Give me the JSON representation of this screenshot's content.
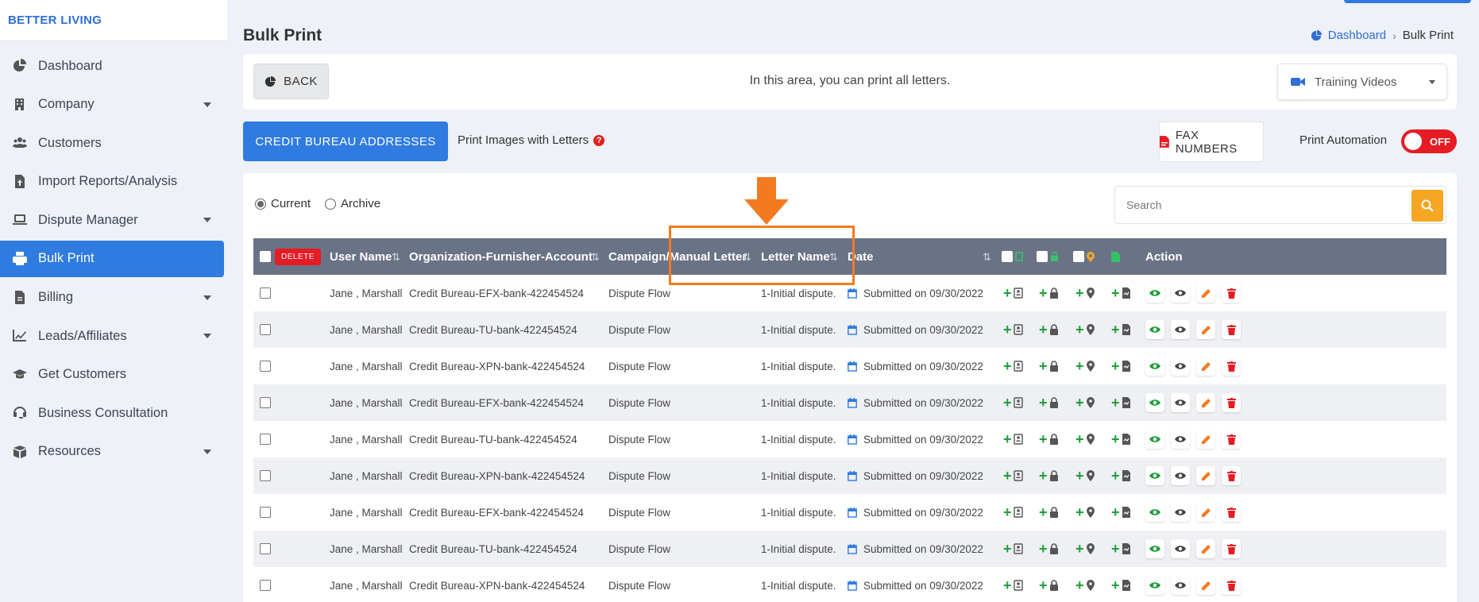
{
  "brand": "BETTER LIVING",
  "sidebar": {
    "items": [
      {
        "label": "Dashboard",
        "icon": "pie-chart-icon",
        "caret": false,
        "active": false
      },
      {
        "label": "Company",
        "icon": "building-icon",
        "caret": true,
        "active": false
      },
      {
        "label": "Customers",
        "icon": "users-icon",
        "caret": false,
        "active": false
      },
      {
        "label": "Import Reports/Analysis",
        "icon": "file-upload-icon",
        "caret": false,
        "active": false
      },
      {
        "label": "Dispute Manager",
        "icon": "laptop-icon",
        "caret": true,
        "active": false
      },
      {
        "label": "Bulk Print",
        "icon": "print-icon",
        "caret": false,
        "active": true
      },
      {
        "label": "Billing",
        "icon": "invoice-icon",
        "caret": true,
        "active": false
      },
      {
        "label": "Leads/Affiliates",
        "icon": "line-chart-icon",
        "caret": true,
        "active": false
      },
      {
        "label": "Get Customers",
        "icon": "graduation-cap-icon",
        "caret": false,
        "active": false
      },
      {
        "label": "Business Consultation",
        "icon": "headset-icon",
        "caret": false,
        "active": false
      },
      {
        "label": "Resources",
        "icon": "box-icon",
        "caret": true,
        "active": false
      }
    ]
  },
  "page": {
    "title": "Bulk Print",
    "breadcrumb": {
      "home": "Dashboard",
      "current": "Bulk Print"
    }
  },
  "toolbar": {
    "back_label": "BACK",
    "info_text": "In this area, you can print all letters.",
    "training_label": "Training Videos",
    "cba_label": "CREDIT BUREAU ADDRESSES",
    "print_images_label": "Print Images with Letters",
    "fax_label": "FAX NUMBERS",
    "automation_label": "Print Automation",
    "toggle_label": "OFF"
  },
  "filters": {
    "current_label": "Current",
    "archive_label": "Archive",
    "search_placeholder": "Search"
  },
  "table": {
    "delete_label": "DELETE",
    "headers": {
      "user": "User Name",
      "org": "Organization-Furnisher-Account",
      "campaign": "Campaign/Manual Letter",
      "letter": "Letter Name",
      "date": "Date",
      "action": "Action"
    },
    "rows": [
      {
        "user": "Jane , Marshall",
        "org": "Credit Bureau-EFX-bank-422454524",
        "campaign": "Dispute Flow",
        "letter": "1-Initial dispute.",
        "date": "Submitted on 09/30/2022"
      },
      {
        "user": "Jane , Marshall",
        "org": "Credit Bureau-TU-bank-422454524",
        "campaign": "Dispute Flow",
        "letter": "1-Initial dispute.",
        "date": "Submitted on 09/30/2022"
      },
      {
        "user": "Jane , Marshall",
        "org": "Credit Bureau-XPN-bank-422454524",
        "campaign": "Dispute Flow",
        "letter": "1-Initial dispute.",
        "date": "Submitted on 09/30/2022"
      },
      {
        "user": "Jane , Marshall",
        "org": "Credit Bureau-EFX-bank-422454524",
        "campaign": "Dispute Flow",
        "letter": "1-Initial dispute.",
        "date": "Submitted on 09/30/2022"
      },
      {
        "user": "Jane , Marshall",
        "org": "Credit Bureau-TU-bank-422454524",
        "campaign": "Dispute Flow",
        "letter": "1-Initial dispute.",
        "date": "Submitted on 09/30/2022"
      },
      {
        "user": "Jane , Marshall",
        "org": "Credit Bureau-XPN-bank-422454524",
        "campaign": "Dispute Flow",
        "letter": "1-Initial dispute.",
        "date": "Submitted on 09/30/2022"
      },
      {
        "user": "Jane , Marshall",
        "org": "Credit Bureau-EFX-bank-422454524",
        "campaign": "Dispute Flow",
        "letter": "1-Initial dispute.",
        "date": "Submitted on 09/30/2022"
      },
      {
        "user": "Jane , Marshall",
        "org": "Credit Bureau-TU-bank-422454524",
        "campaign": "Dispute Flow",
        "letter": "1-Initial dispute.",
        "date": "Submitted on 09/30/2022"
      },
      {
        "user": "Jane , Marshall",
        "org": "Credit Bureau-XPN-bank-422454524",
        "campaign": "Dispute Flow",
        "letter": "1-Initial dispute.",
        "date": "Submitted on 09/30/2022"
      }
    ]
  },
  "colors": {
    "accent": "#2f7be0",
    "danger": "#e61b23",
    "highlight": "#f47a20",
    "header_bg": "#6a7386",
    "success": "#1e9e3a"
  }
}
